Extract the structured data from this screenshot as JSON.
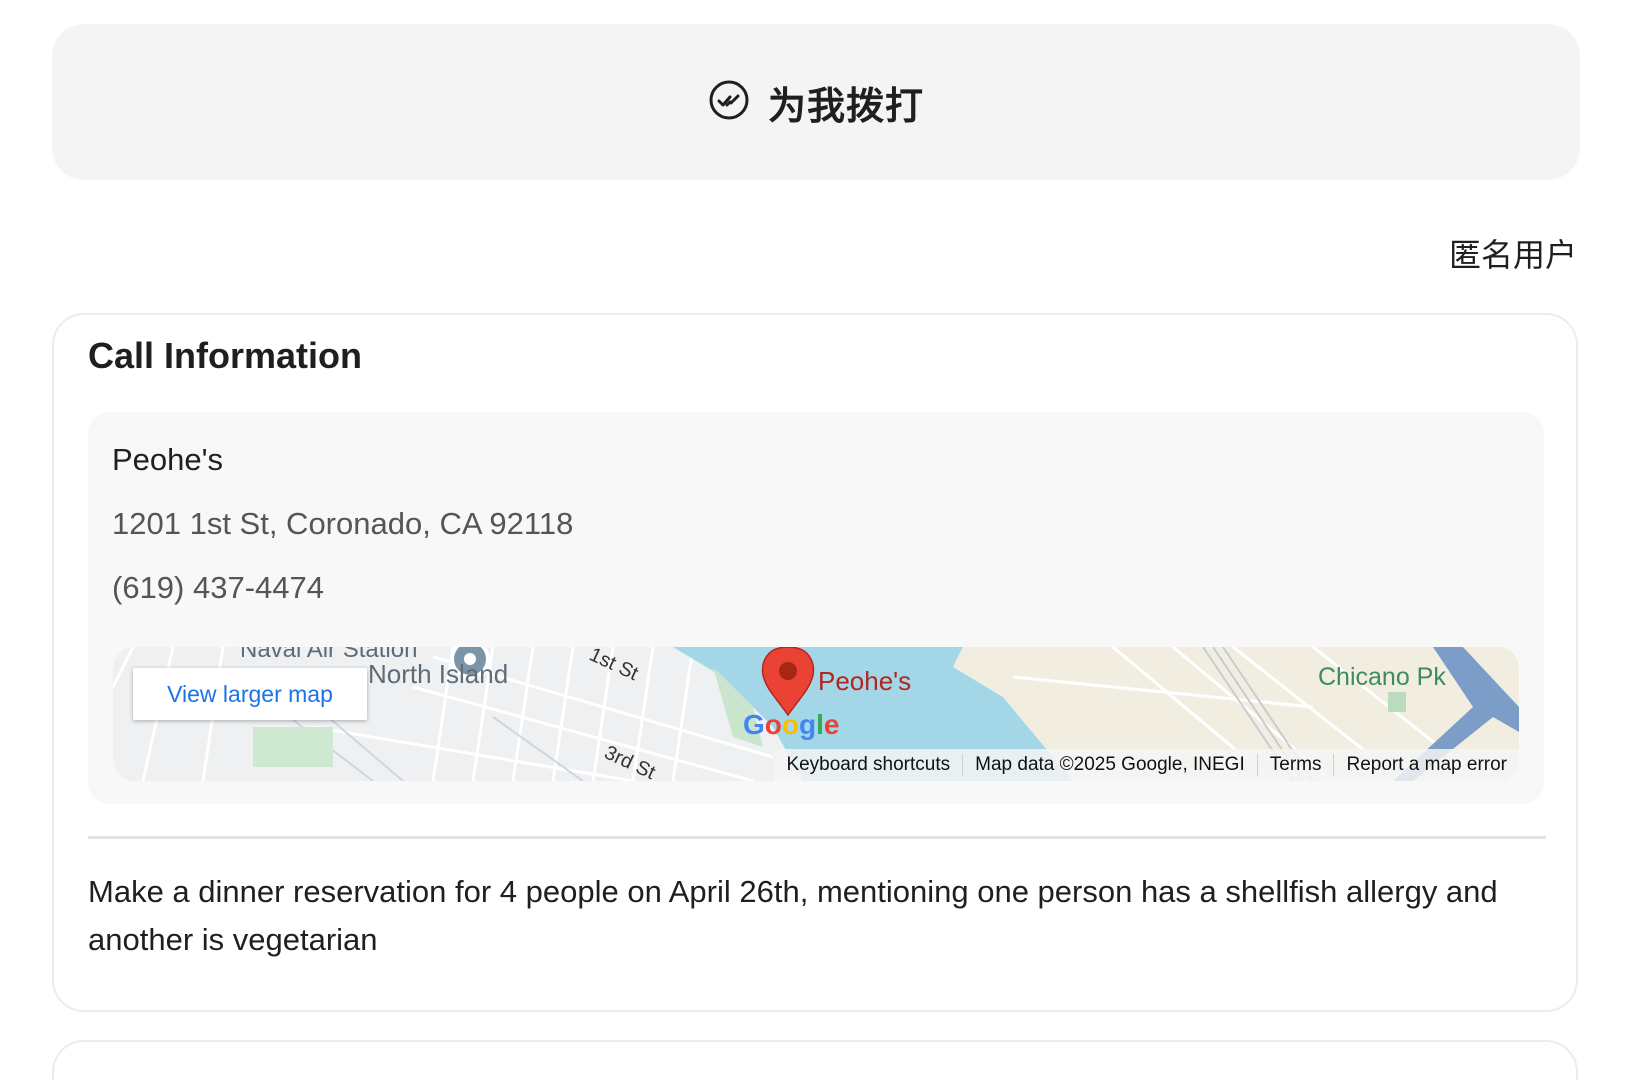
{
  "header": {
    "title": "为我拨打",
    "icon": "check-circle-icon"
  },
  "user": {
    "label": "匿名用户"
  },
  "card": {
    "title": "Call Information",
    "place": {
      "name": "Peohe's",
      "address": "1201 1st St, Coronado, CA 92118",
      "phone": "(619) 437-4474"
    },
    "map": {
      "view_larger_label": "View larger map",
      "labels": {
        "naval_station": "Naval Air Station",
        "north_island": "North Island",
        "first_st": "1st St",
        "third_st": "3rd St",
        "marker": "Peohe's",
        "chicano_pk": "Chicano Pk",
        "google": "Google"
      },
      "footer": {
        "shortcuts": "Keyboard shortcuts",
        "map_data": "Map data ©2025 Google, INEGI",
        "terms": "Terms",
        "report": "Report a map error"
      },
      "colors": {
        "water": "#a3d7e8",
        "land": "#eef0f2",
        "marker": "#ea4335"
      }
    },
    "task": "Make a dinner reservation for 4 people on April 26th, mentioning one person has a shellfish allergy and another is vegetarian"
  }
}
